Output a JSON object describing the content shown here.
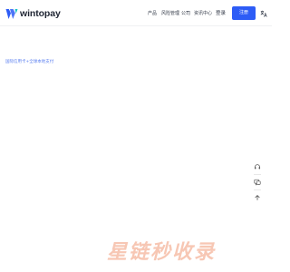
{
  "brand": {
    "name": "wintopay",
    "accent": "#2d5cf6"
  },
  "nav": [
    {
      "label": "产品"
    },
    {
      "label": "风险管理"
    },
    {
      "label": "公司"
    },
    {
      "label": "资讯中心"
    }
  ],
  "header": {
    "login_label": "登录",
    "register_label": "注册",
    "lang_icon": "translate-icon"
  },
  "hero": {
    "tagline": "国际信用卡+全球本地支付"
  },
  "side_tools": [
    {
      "icon": "headset-icon"
    },
    {
      "icon": "chat-icon"
    },
    {
      "icon": "arrow-up-icon"
    }
  ],
  "watermark": {
    "text": "星链秒收录"
  }
}
